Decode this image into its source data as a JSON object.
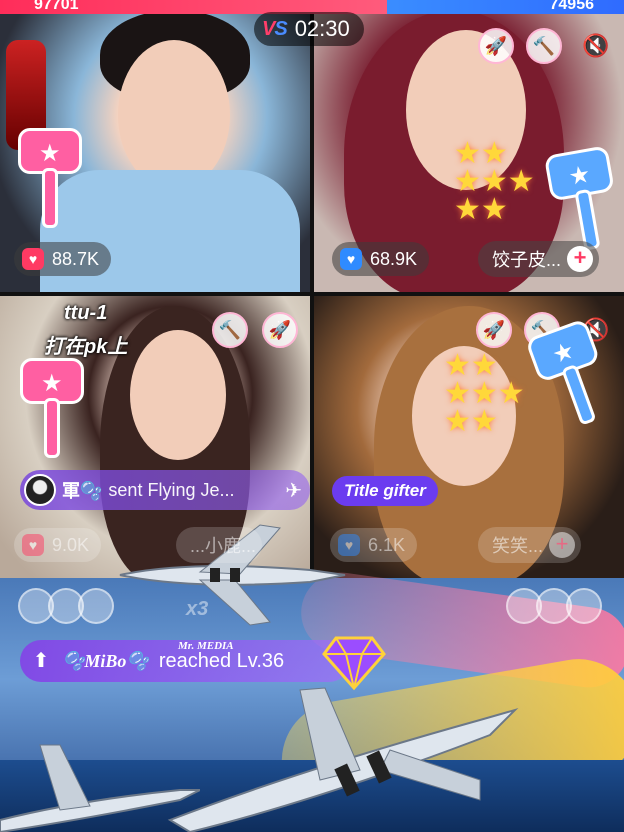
{
  "battle": {
    "red_score": "97701",
    "blue_score": "74956",
    "vs_label_v": "V",
    "vs_label_s": "S",
    "timer": "02:30",
    "colors": {
      "red": "#ff2d5a",
      "blue": "#2f6bff"
    }
  },
  "hosts": {
    "top_left": {
      "likes": "88.7K"
    },
    "top_right": {
      "likes": "68.9K",
      "name": "饺子皮..."
    },
    "bottom_left": {
      "likes": "9.0K",
      "name": "...小鹿..."
    },
    "bottom_right": {
      "likes": "6.1K",
      "name": "笑笑..."
    }
  },
  "overlay": {
    "pk_line1": "ttu-1",
    "pk_line2": "打在pk上"
  },
  "gift": {
    "sender": "軍🫧",
    "message": "sent Flying Je...",
    "title_gifter": "Title gifter"
  },
  "combo": "x3",
  "level_up": {
    "media_tag": "Mr. MEDIA",
    "user": "🫧MiBo🫧",
    "text": "reached Lv.36"
  },
  "icons": {
    "heart": "heart-icon",
    "plus": "plus-icon",
    "mute": "mute-icon",
    "hammer": "hammer-icon",
    "arrow": "up-arrow-icon",
    "diamond": "diamond-icon"
  }
}
